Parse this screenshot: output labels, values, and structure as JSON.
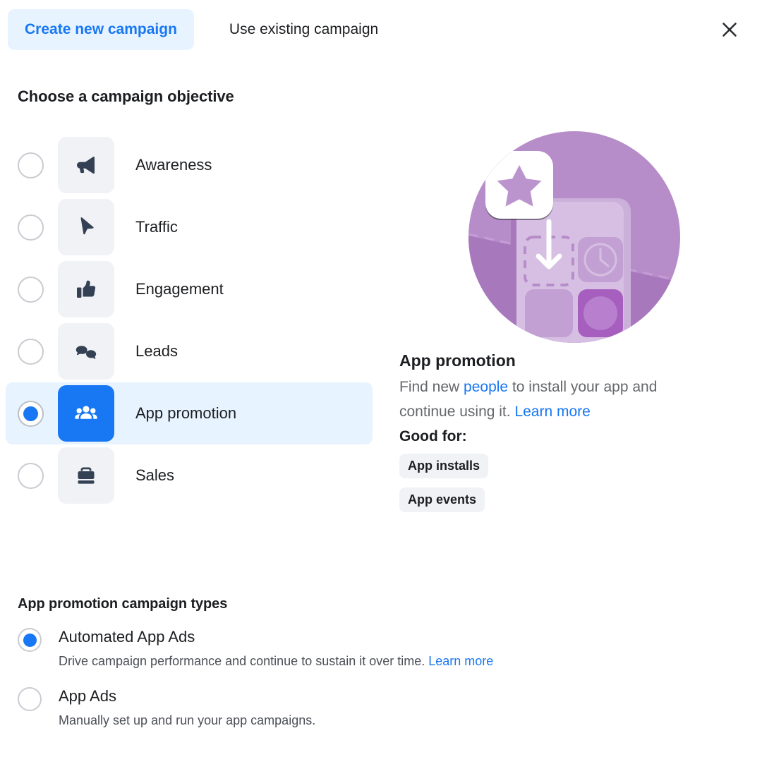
{
  "tabs": [
    {
      "label": "Create new campaign",
      "active": true,
      "name": "tab-create-new-campaign"
    },
    {
      "label": "Use existing campaign",
      "active": false,
      "name": "tab-use-existing-campaign"
    }
  ],
  "close_icon": "close-icon",
  "objective_section": {
    "title": "Choose a campaign objective",
    "items": [
      {
        "label": "Awareness",
        "icon": "megaphone-icon",
        "selected": false
      },
      {
        "label": "Traffic",
        "icon": "cursor-arrow-icon",
        "selected": false
      },
      {
        "label": "Engagement",
        "icon": "thumbs-up-icon",
        "selected": false
      },
      {
        "label": "Leads",
        "icon": "speech-bubbles-icon",
        "selected": false
      },
      {
        "label": "App promotion",
        "icon": "people-group-icon",
        "selected": true
      },
      {
        "label": "Sales",
        "icon": "briefcase-icon",
        "selected": false
      }
    ]
  },
  "detail": {
    "illustration": "app-promotion-illustration",
    "title": "App promotion",
    "desc_part1": "Find new ",
    "desc_link1": "people",
    "desc_part2": " to install your app and continue using it. ",
    "desc_link2": "Learn more",
    "good_for_label": "Good for:",
    "good_for_pills": [
      "App installs",
      "App events"
    ]
  },
  "types_section": {
    "title": "App promotion campaign types",
    "items": [
      {
        "label": "Automated App Ads",
        "desc": "Drive campaign performance and continue to sustain it over time. ",
        "link": "Learn more",
        "selected": true
      },
      {
        "label": "App Ads",
        "desc": "Manually set up and run your app campaigns.",
        "link": "",
        "selected": false
      }
    ]
  },
  "colors": {
    "accent_blue": "#1877f2",
    "tab_active_bg": "#e7f3ff",
    "row_selected_bg": "#e7f3ff",
    "tile_bg": "#f0f2f5",
    "icon_dark": "#344054",
    "text_primary": "#1c1e21",
    "text_secondary": "#65676b",
    "illustration_purple": "#b189c4"
  }
}
